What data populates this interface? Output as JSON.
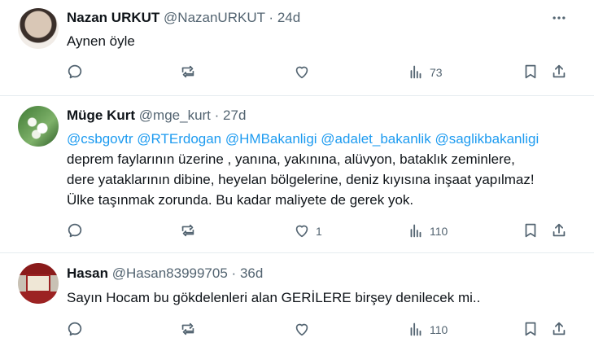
{
  "tweets": [
    {
      "name": "Nazan URKUT",
      "handle": "@NazanURKUT",
      "separator": "·",
      "age": "24d",
      "text": "Aynen öyle",
      "reply_count": "",
      "retweet_count": "",
      "like_count": "",
      "view_count": "73"
    },
    {
      "name": "Müge Kurt",
      "handle": "@mge_kurt",
      "separator": "·",
      "age": "27d",
      "mentions": [
        "@csbgovtr",
        "@RTErdogan",
        "@HMBakanligi",
        "@adalet_bakanlik",
        "@saglikbakanligi"
      ],
      "lines": [
        "deprem faylarının üzerine , yanına, yakınına, alüvyon, bataklık zeminlere,",
        "dere yataklarının dibine, heyelan bölgelerine, deniz kıyısına inşaat yapılmaz!",
        "Ülke taşınmak zorunda. Bu kadar maliyete de gerek yok."
      ],
      "reply_count": "",
      "retweet_count": "",
      "like_count": "1",
      "view_count": "110"
    },
    {
      "name": "Hasan",
      "handle": "@Hasan83999705",
      "separator": "·",
      "age": "36d",
      "text": "Sayın Hocam bu gökdelenleri alan GERİLERE birşey denilecek mi..",
      "reply_count": "",
      "retweet_count": "",
      "like_count": "",
      "view_count": "110"
    }
  ],
  "icons": {
    "reply": "reply-icon",
    "retweet": "retweet-icon",
    "like": "heart-icon",
    "views": "views-icon",
    "bookmark": "bookmark-icon",
    "share": "share-icon",
    "more": "more-icon"
  },
  "colors": {
    "text": "#0f1419",
    "muted": "#536471",
    "link": "#1d9bf0",
    "divider": "#e6ecf0"
  }
}
